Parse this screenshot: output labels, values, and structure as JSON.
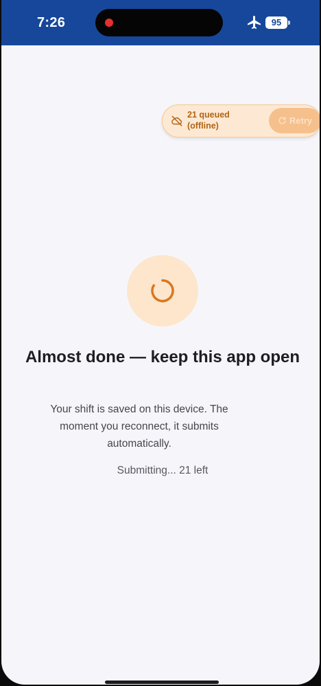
{
  "status_bar": {
    "time": "7:26",
    "battery": "95",
    "icons": [
      "recording-dot-icon",
      "airplane-mode-icon",
      "battery-icon"
    ]
  },
  "queue": {
    "text": "21 queued (offline)",
    "retry_label": "Retry",
    "icon": "cloud-offline-icon"
  },
  "main": {
    "headline": "Almost done — keep this app open",
    "body": "Your shift is saved on this device. The moment you reconnect, it submits automatically.",
    "progress": "Submitting... 21 left"
  },
  "colors": {
    "status_bar": "#17479a",
    "accent": "#d9771f",
    "pill_bg": "#fde9d3",
    "background": "#f6f6fa"
  }
}
